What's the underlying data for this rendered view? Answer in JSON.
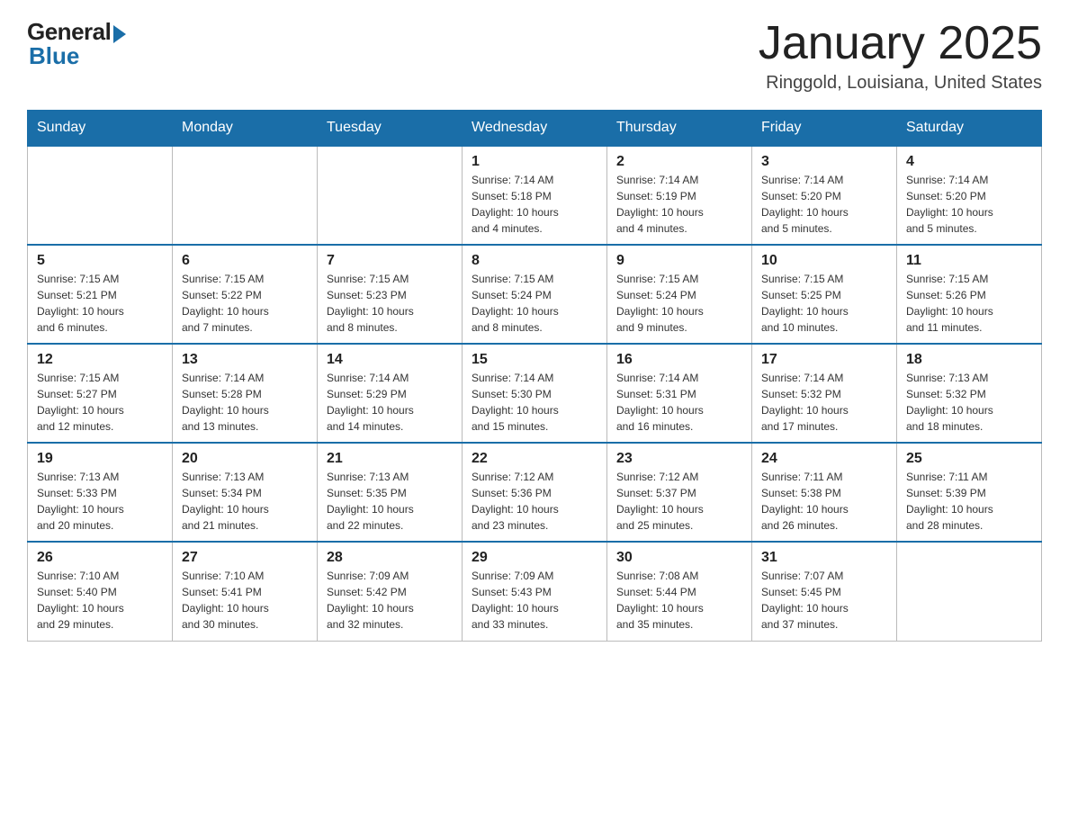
{
  "logo": {
    "general": "General",
    "blue": "Blue"
  },
  "title": {
    "month": "January 2025",
    "location": "Ringgold, Louisiana, United States"
  },
  "days_of_week": [
    "Sunday",
    "Monday",
    "Tuesday",
    "Wednesday",
    "Thursday",
    "Friday",
    "Saturday"
  ],
  "weeks": [
    [
      {
        "day": "",
        "info": ""
      },
      {
        "day": "",
        "info": ""
      },
      {
        "day": "",
        "info": ""
      },
      {
        "day": "1",
        "info": "Sunrise: 7:14 AM\nSunset: 5:18 PM\nDaylight: 10 hours\nand 4 minutes."
      },
      {
        "day": "2",
        "info": "Sunrise: 7:14 AM\nSunset: 5:19 PM\nDaylight: 10 hours\nand 4 minutes."
      },
      {
        "day": "3",
        "info": "Sunrise: 7:14 AM\nSunset: 5:20 PM\nDaylight: 10 hours\nand 5 minutes."
      },
      {
        "day": "4",
        "info": "Sunrise: 7:14 AM\nSunset: 5:20 PM\nDaylight: 10 hours\nand 5 minutes."
      }
    ],
    [
      {
        "day": "5",
        "info": "Sunrise: 7:15 AM\nSunset: 5:21 PM\nDaylight: 10 hours\nand 6 minutes."
      },
      {
        "day": "6",
        "info": "Sunrise: 7:15 AM\nSunset: 5:22 PM\nDaylight: 10 hours\nand 7 minutes."
      },
      {
        "day": "7",
        "info": "Sunrise: 7:15 AM\nSunset: 5:23 PM\nDaylight: 10 hours\nand 8 minutes."
      },
      {
        "day": "8",
        "info": "Sunrise: 7:15 AM\nSunset: 5:24 PM\nDaylight: 10 hours\nand 8 minutes."
      },
      {
        "day": "9",
        "info": "Sunrise: 7:15 AM\nSunset: 5:24 PM\nDaylight: 10 hours\nand 9 minutes."
      },
      {
        "day": "10",
        "info": "Sunrise: 7:15 AM\nSunset: 5:25 PM\nDaylight: 10 hours\nand 10 minutes."
      },
      {
        "day": "11",
        "info": "Sunrise: 7:15 AM\nSunset: 5:26 PM\nDaylight: 10 hours\nand 11 minutes."
      }
    ],
    [
      {
        "day": "12",
        "info": "Sunrise: 7:15 AM\nSunset: 5:27 PM\nDaylight: 10 hours\nand 12 minutes."
      },
      {
        "day": "13",
        "info": "Sunrise: 7:14 AM\nSunset: 5:28 PM\nDaylight: 10 hours\nand 13 minutes."
      },
      {
        "day": "14",
        "info": "Sunrise: 7:14 AM\nSunset: 5:29 PM\nDaylight: 10 hours\nand 14 minutes."
      },
      {
        "day": "15",
        "info": "Sunrise: 7:14 AM\nSunset: 5:30 PM\nDaylight: 10 hours\nand 15 minutes."
      },
      {
        "day": "16",
        "info": "Sunrise: 7:14 AM\nSunset: 5:31 PM\nDaylight: 10 hours\nand 16 minutes."
      },
      {
        "day": "17",
        "info": "Sunrise: 7:14 AM\nSunset: 5:32 PM\nDaylight: 10 hours\nand 17 minutes."
      },
      {
        "day": "18",
        "info": "Sunrise: 7:13 AM\nSunset: 5:32 PM\nDaylight: 10 hours\nand 18 minutes."
      }
    ],
    [
      {
        "day": "19",
        "info": "Sunrise: 7:13 AM\nSunset: 5:33 PM\nDaylight: 10 hours\nand 20 minutes."
      },
      {
        "day": "20",
        "info": "Sunrise: 7:13 AM\nSunset: 5:34 PM\nDaylight: 10 hours\nand 21 minutes."
      },
      {
        "day": "21",
        "info": "Sunrise: 7:13 AM\nSunset: 5:35 PM\nDaylight: 10 hours\nand 22 minutes."
      },
      {
        "day": "22",
        "info": "Sunrise: 7:12 AM\nSunset: 5:36 PM\nDaylight: 10 hours\nand 23 minutes."
      },
      {
        "day": "23",
        "info": "Sunrise: 7:12 AM\nSunset: 5:37 PM\nDaylight: 10 hours\nand 25 minutes."
      },
      {
        "day": "24",
        "info": "Sunrise: 7:11 AM\nSunset: 5:38 PM\nDaylight: 10 hours\nand 26 minutes."
      },
      {
        "day": "25",
        "info": "Sunrise: 7:11 AM\nSunset: 5:39 PM\nDaylight: 10 hours\nand 28 minutes."
      }
    ],
    [
      {
        "day": "26",
        "info": "Sunrise: 7:10 AM\nSunset: 5:40 PM\nDaylight: 10 hours\nand 29 minutes."
      },
      {
        "day": "27",
        "info": "Sunrise: 7:10 AM\nSunset: 5:41 PM\nDaylight: 10 hours\nand 30 minutes."
      },
      {
        "day": "28",
        "info": "Sunrise: 7:09 AM\nSunset: 5:42 PM\nDaylight: 10 hours\nand 32 minutes."
      },
      {
        "day": "29",
        "info": "Sunrise: 7:09 AM\nSunset: 5:43 PM\nDaylight: 10 hours\nand 33 minutes."
      },
      {
        "day": "30",
        "info": "Sunrise: 7:08 AM\nSunset: 5:44 PM\nDaylight: 10 hours\nand 35 minutes."
      },
      {
        "day": "31",
        "info": "Sunrise: 7:07 AM\nSunset: 5:45 PM\nDaylight: 10 hours\nand 37 minutes."
      },
      {
        "day": "",
        "info": ""
      }
    ]
  ]
}
